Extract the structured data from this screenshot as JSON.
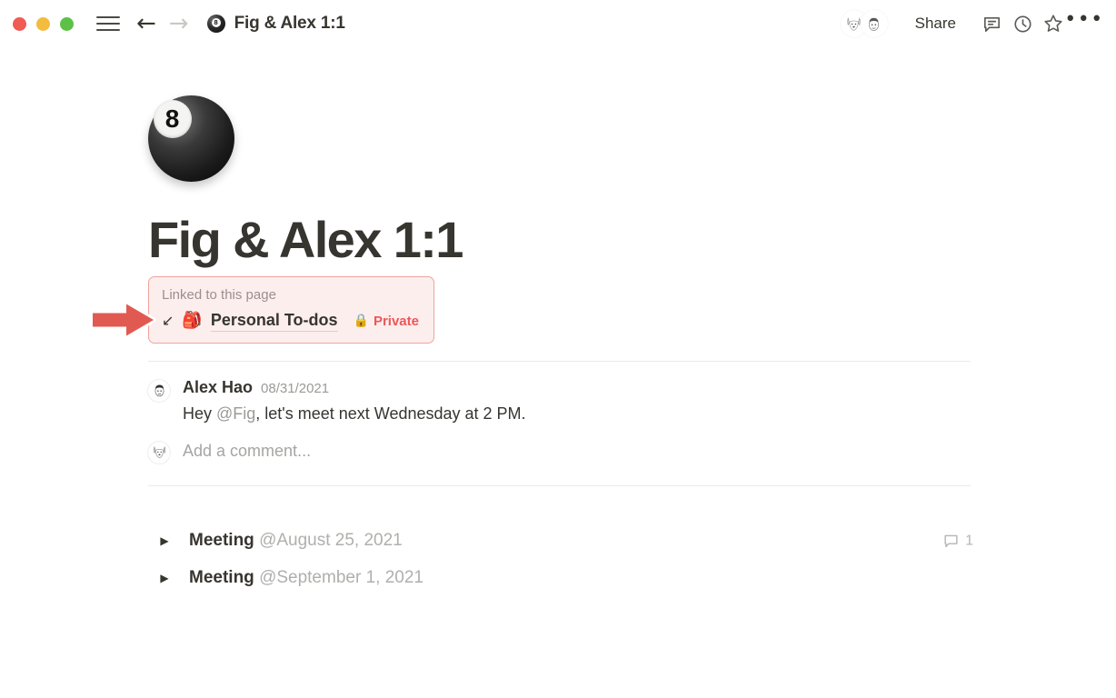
{
  "titlebar": {
    "window_controls": [
      "close",
      "minimize",
      "maximize"
    ],
    "menu_icon": "hamburger-menu-icon",
    "back_label": "←",
    "forward_label": "→",
    "doc_icon": "eight-ball-icon",
    "doc_title": "Fig & Alex 1:1",
    "avatars": [
      {
        "name": "dog-face-avatar",
        "glyph": "🐶"
      },
      {
        "name": "man-face-avatar",
        "glyph": "👨"
      }
    ],
    "share_label": "Share",
    "comment_icon": "comment-icon",
    "history_icon": "clock-history-icon",
    "favorite_icon": "star-icon",
    "more_label": "•••"
  },
  "page": {
    "icon_glyph": "8",
    "icon_name": "eight-ball-page-icon",
    "title": "Fig & Alex 1:1"
  },
  "linked": {
    "label": "Linked to this page",
    "arrow_glyph": "↙",
    "page_emoji": "🎒",
    "page_name": "Personal To-dos",
    "lock_glyph": "🔒",
    "private_label": "Private",
    "accent_color": "#eb5757",
    "background_color": "#fdeeee",
    "border_color": "#f0a39d"
  },
  "annotation": {
    "arrow_color": "#e05a52",
    "name": "red-pointer-arrow"
  },
  "comments": [
    {
      "avatar_glyph": "👨",
      "avatar_name": "man-face-avatar",
      "author": "Alex Hao",
      "date": "08/31/2021",
      "text_before": "Hey ",
      "mention": "@Fig",
      "text_after": ", let's meet next Wednesday at 2 PM."
    }
  ],
  "add_comment": {
    "avatar_glyph": "🐶",
    "avatar_name": "dog-face-avatar",
    "placeholder": "Add a comment..."
  },
  "toggles": [
    {
      "triangle": "▶",
      "title": "Meeting ",
      "date_mention": "@August 25, 2021",
      "comment_count": "1"
    },
    {
      "triangle": "▶",
      "title": "Meeting ",
      "date_mention": "@September 1, 2021",
      "comment_count": ""
    }
  ]
}
